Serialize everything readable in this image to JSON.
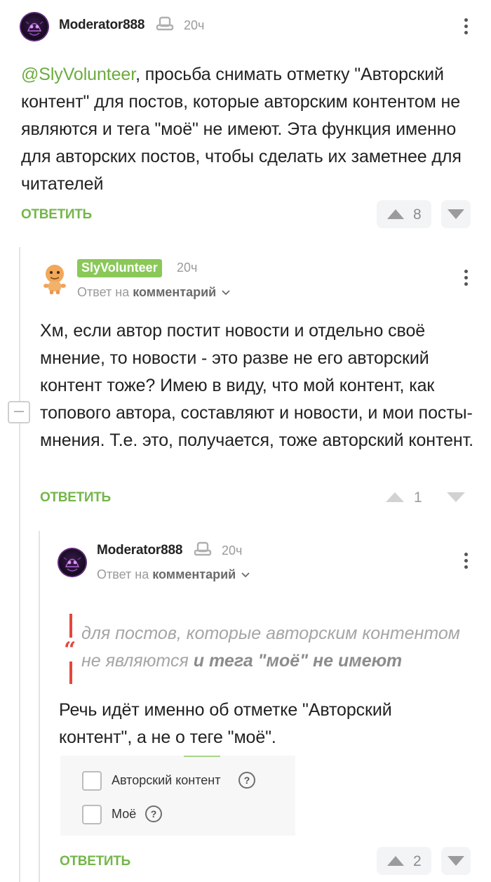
{
  "comment1": {
    "username": "Moderator888",
    "time": "20ч",
    "mention": "@SlyVolunteer",
    "text": ", просьба снимать отметку \"Авторский контент\" для постов, которые авторским контентом не являются и тега \"моё\" не имеют. Эта функция именно для авторских постов, чтобы сделать их заметнее для читателей",
    "reply_label": "ОТВЕТИТЬ",
    "votes": "8"
  },
  "comment2": {
    "username": "SlyVolunteer",
    "time": "20ч",
    "reply_prefix": "Ответ на",
    "reply_target": "комментарий",
    "text": "Хм, если автор постит новости и отдельно своё мнение, то новости - это разве не его авторский контент тоже? Имею в виду, что мой контент, как топового автора, составляют и новости, и мои посты-мнения. Т.е. это, получается, тоже авторский контент.",
    "reply_label": "ОТВЕТИТЬ",
    "votes": "1"
  },
  "comment3": {
    "username": "Moderator888",
    "time": "20ч",
    "reply_prefix": "Ответ на",
    "reply_target": "комментарий",
    "quote_plain": "для постов, которые авторским контентом не являются",
    "quote_bold": "и тега \"моё\" не имеют",
    "text": "Речь идёт именно об отметке \"Авторский контент\", а не о теге \"моё\".",
    "embed_options": [
      "Авторский контент",
      "Моё"
    ],
    "embed_help": "?",
    "reply_label": "ОТВЕТИТЬ",
    "votes": "2"
  },
  "colors": {
    "accent_green": "#74b64a",
    "mention_green": "#6cab3e",
    "quote_red": "#e4473b"
  }
}
